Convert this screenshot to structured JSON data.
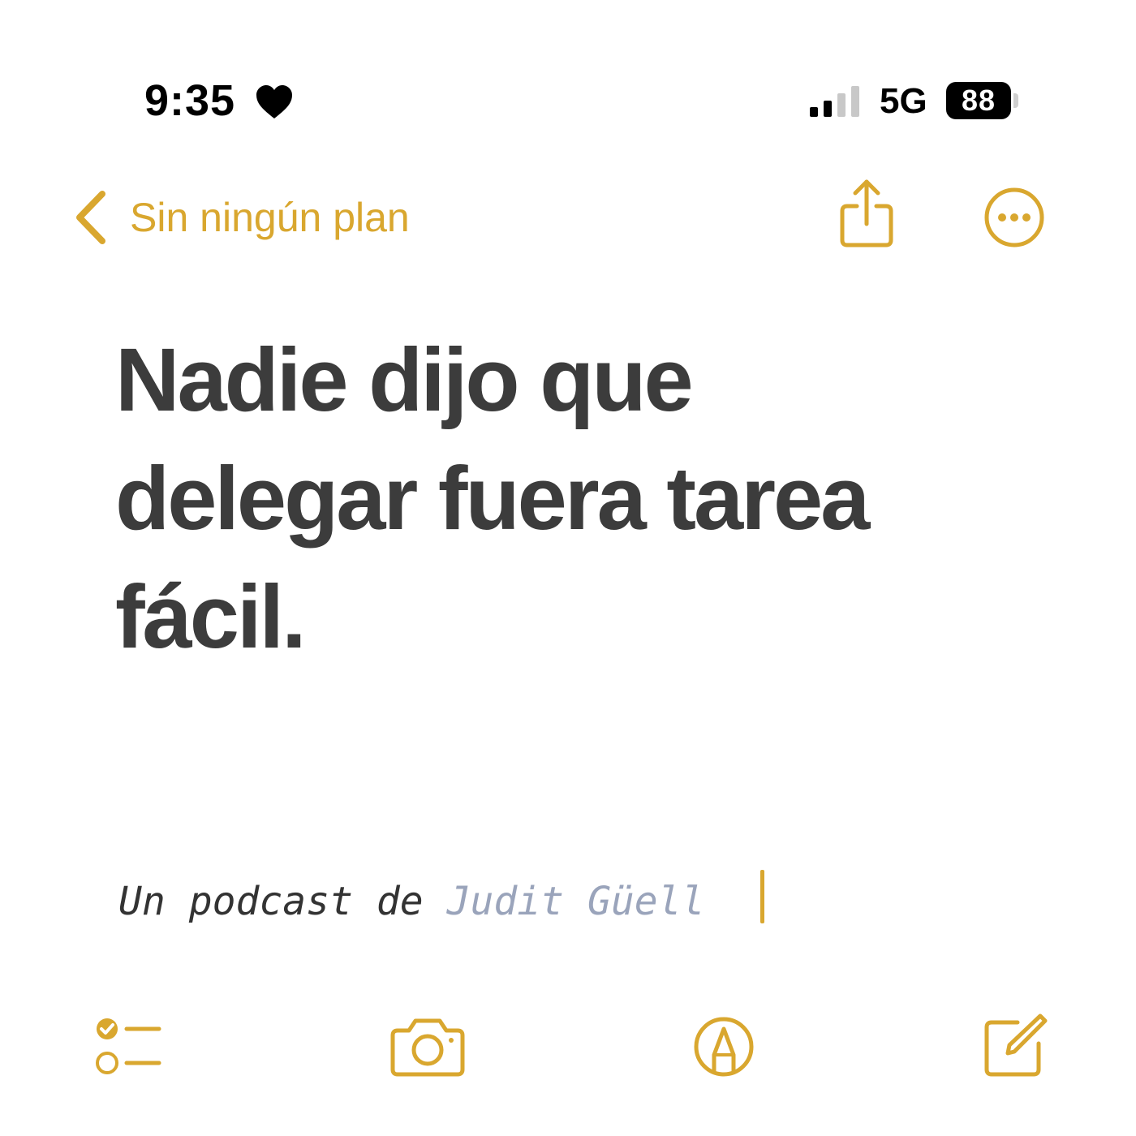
{
  "status_bar": {
    "time": "9:35",
    "network": "5G",
    "battery": "88",
    "icons": [
      "heart-icon",
      "cellular-signal-icon",
      "battery-icon"
    ]
  },
  "nav": {
    "back_label": "Sin ningún plan",
    "icons": [
      "chevron-left-icon",
      "share-icon",
      "more-icon"
    ]
  },
  "note": {
    "title_line1": "Nadie dijo que",
    "title_line2": "delegar fuera tarea",
    "title_line3": "fácil.",
    "byline_prefix": "Un podcast de ",
    "byline_author": "Judit Güell"
  },
  "toolbar": {
    "icons": [
      "checklist-icon",
      "camera-icon",
      "markup-icon",
      "compose-icon"
    ]
  },
  "colors": {
    "accent": "#d9a72f",
    "title_text": "#3c3c3c",
    "author_text": "#9aa4bb",
    "background": "#ffffff"
  }
}
